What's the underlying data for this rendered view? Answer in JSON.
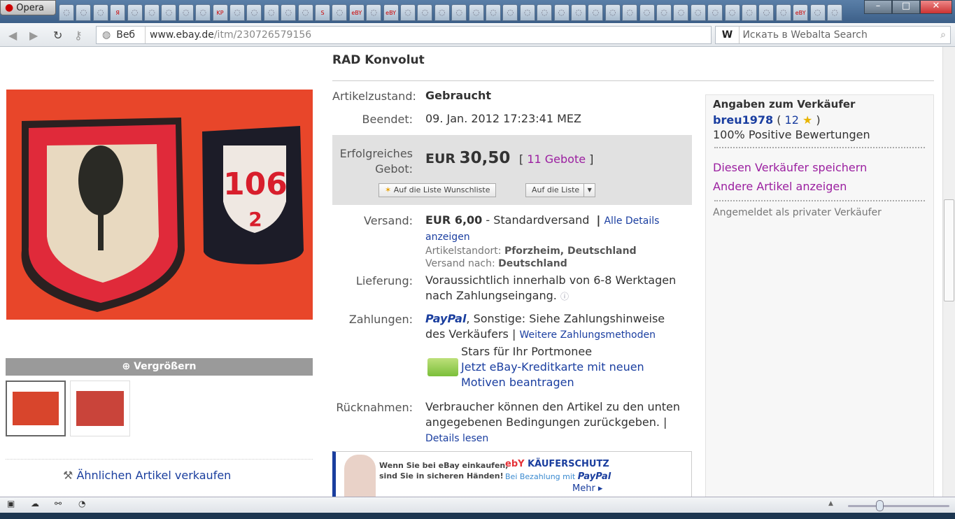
{
  "browser": {
    "app_name": "Opera",
    "address_prefix": "Веб",
    "url_host": "www.ebay.de",
    "url_path": "/itm/230726579156",
    "search_engine_letter": "W",
    "search_placeholder": "Искать в Webalta Search",
    "tab_labels": [
      "Я",
      "KP LIFE",
      "S",
      "eBY",
      "eBY",
      "eBY"
    ]
  },
  "image": {
    "badge_number": "106",
    "badge_sub": "2",
    "enlarge_label": "Vergrößern"
  },
  "left": {
    "sell_similar": "Ähnlichen Artikel verkaufen"
  },
  "item": {
    "title": "RAD Konvolut",
    "condition_label": "Artikelzustand:",
    "condition": "Gebraucht",
    "ended_label": "Beendet:",
    "ended": "09. Jan. 2012 17:23:41 MEZ",
    "bid_label_1": "Erfolgreiches",
    "bid_label_2": "Gebot:",
    "price_currency": "EUR",
    "price": "30,50",
    "bids": "11 Gebote",
    "watch_button": "Auf die Liste Wunschliste",
    "list_button": "Auf die Liste",
    "shipping_label": "Versand:",
    "shipping_price": "EUR 6,00",
    "shipping_type": "- Standardversand",
    "shipping_details": "Alle Details anzeigen",
    "location_label": "Artikelstandort:",
    "location": "Pforzheim, Deutschland",
    "ships_to_label": "Versand nach:",
    "ships_to": "Deutschland",
    "delivery_label": "Lieferung:",
    "delivery": "Voraussichtlich innerhalb von 6-8 Werktagen nach Zahlungseingang.",
    "payment_label": "Zahlungen:",
    "paypal": "PayPal",
    "payment_other": ", Sonstige: Siehe Zahlungshinweise des Verkäufers |",
    "payment_more": "Weitere Zahlungsmethoden",
    "card_promo_title": "Stars für Ihr Portmonee",
    "card_promo_link": "Jetzt eBay-Kreditkarte mit neuen Motiven beantragen",
    "returns_label": "Rücknahmen:",
    "returns": "Verbraucher können den Artikel zu den unten angegebenen Bedingungen zurückgeben. |",
    "returns_link": "Details lesen"
  },
  "banner": {
    "text1": "Wenn Sie bei eBay einkaufen,",
    "text2": "sind Sie in sicheren Händen!",
    "brand": "ebY",
    "title": "KÄUFERSCHUTZ",
    "sub": "Bei Bezahlung mit",
    "paypal": "PayPal",
    "more": "Mehr ▸"
  },
  "seller": {
    "heading": "Angaben zum Verkäufer",
    "name": "breu1978",
    "score": "12",
    "positive": "100% Positive Bewertungen",
    "save": "Diesen Verkäufer speichern",
    "other": "Andere Artikel anzeigen",
    "registered": "Angemeldet als privater Verkäufer"
  }
}
